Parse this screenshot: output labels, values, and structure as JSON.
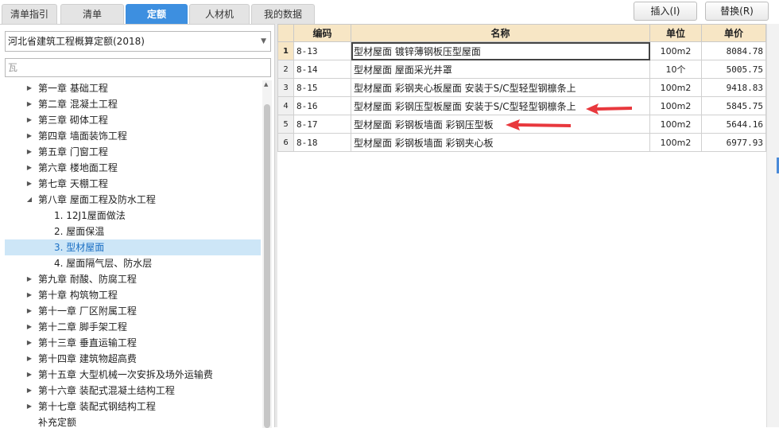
{
  "tabs": [
    {
      "label": "清单指引",
      "active": false
    },
    {
      "label": "清单",
      "active": false
    },
    {
      "label": "定额",
      "active": true
    },
    {
      "label": "人材机",
      "active": false
    },
    {
      "label": "我的数据",
      "active": false
    }
  ],
  "buttons": {
    "insert": "插入(I)",
    "replace": "替换(R)"
  },
  "library": {
    "selected": "河北省建筑工程概算定额(2018)"
  },
  "search": {
    "value": "瓦"
  },
  "tree": [
    {
      "label": "第一章 基础工程",
      "expanded": false,
      "level": 0
    },
    {
      "label": "第二章 混凝土工程",
      "expanded": false,
      "level": 0
    },
    {
      "label": "第三章 砌体工程",
      "expanded": false,
      "level": 0
    },
    {
      "label": "第四章 墙面装饰工程",
      "expanded": false,
      "level": 0
    },
    {
      "label": "第五章 门窗工程",
      "expanded": false,
      "level": 0
    },
    {
      "label": "第六章 楼地面工程",
      "expanded": false,
      "level": 0
    },
    {
      "label": "第七章 天棚工程",
      "expanded": false,
      "level": 0
    },
    {
      "label": "第八章 屋面工程及防水工程",
      "expanded": true,
      "level": 0
    },
    {
      "label": "1. 12J1屋面做法",
      "level": 1
    },
    {
      "label": "2. 屋面保温",
      "level": 1
    },
    {
      "label": "3. 型材屋面",
      "level": 1,
      "selected": true
    },
    {
      "label": "4. 屋面隔气层、防水层",
      "level": 1
    },
    {
      "label": "第九章 耐酸、防腐工程",
      "expanded": false,
      "level": 0
    },
    {
      "label": "第十章 构筑物工程",
      "expanded": false,
      "level": 0
    },
    {
      "label": "第十一章 厂区附属工程",
      "expanded": false,
      "level": 0
    },
    {
      "label": "第十二章 脚手架工程",
      "expanded": false,
      "level": 0
    },
    {
      "label": "第十三章 垂直运输工程",
      "expanded": false,
      "level": 0
    },
    {
      "label": "第十四章 建筑物超高费",
      "expanded": false,
      "level": 0
    },
    {
      "label": "第十五章 大型机械一次安拆及场外运输费",
      "expanded": false,
      "level": 0
    },
    {
      "label": "第十六章 装配式混凝土结构工程",
      "expanded": false,
      "level": 0
    },
    {
      "label": "第十七章 装配式钢结构工程",
      "expanded": false,
      "level": 0
    },
    {
      "label": "补充定额",
      "level": 0,
      "leaf": true
    }
  ],
  "grid": {
    "headers": {
      "code": "编码",
      "name": "名称",
      "unit": "单位",
      "price": "单价"
    },
    "rows": [
      {
        "no": "1",
        "code": "8-13",
        "name": "型材屋面 镀锌薄钢板压型屋面",
        "unit": "100m2",
        "price": "8084.78"
      },
      {
        "no": "2",
        "code": "8-14",
        "name": "型材屋面 屋面采光井罩",
        "unit": "10个",
        "price": "5005.75"
      },
      {
        "no": "3",
        "code": "8-15",
        "name": "型材屋面 彩钢夹心板屋面 安装于S/C型轻型钢檩条上",
        "unit": "100m2",
        "price": "9418.83"
      },
      {
        "no": "4",
        "code": "8-16",
        "name": "型材屋面 彩钢压型板屋面 安装于S/C型轻型钢檩条上",
        "unit": "100m2",
        "price": "5845.75"
      },
      {
        "no": "5",
        "code": "8-17",
        "name": "型材屋面 彩钢板墙面 彩钢压型板",
        "unit": "100m2",
        "price": "5644.16"
      },
      {
        "no": "6",
        "code": "8-18",
        "name": "型材屋面 彩钢板墙面 彩钢夹心板",
        "unit": "100m2",
        "price": "6977.93"
      }
    ]
  },
  "colors": {
    "accent": "#3d8fe0",
    "header_bg": "#f7e6c5",
    "selection": "#cde6f7",
    "annotation_arrow": "#e8383d"
  },
  "icons": {
    "expand": "triangle-right-icon",
    "collapse": "triangle-down-icon",
    "dropdown": "chevron-down-icon"
  }
}
